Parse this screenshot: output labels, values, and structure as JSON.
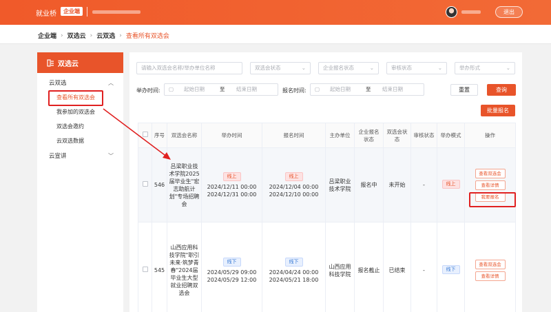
{
  "header": {
    "brand": "就业桥",
    "brand_badge": "企业端",
    "logout": "退出"
  },
  "breadcrumb": [
    "企业端",
    "双选云",
    "云双选",
    "查看所有双选会"
  ],
  "sidebar": {
    "title": "双选云",
    "groups": [
      {
        "label": "云双选",
        "expanded": true,
        "items": [
          "查看所有双选会",
          "我参加的双选会",
          "双选会邀约",
          "云双选数据"
        ]
      },
      {
        "label": "云宣讲",
        "expanded": false,
        "items": []
      }
    ],
    "active_item": "查看所有双选会"
  },
  "filters": {
    "search_placeholder": "请输入双选会名称/举办单位名称",
    "status_placeholder": "双选会状态",
    "enroll_status_placeholder": "企业报名状态",
    "review_status_placeholder": "审核状态",
    "form_placeholder": "举办形式",
    "hold_time_label": "举办时间:",
    "enroll_time_label": "报名时间:",
    "start_date_placeholder": "起始日期",
    "range_to": "至",
    "end_date_placeholder": "结束日期",
    "reset": "重置",
    "query": "查询",
    "batch": "批量报名"
  },
  "table": {
    "columns": [
      "序号",
      "双选会名称",
      "举办时间",
      "报名时间",
      "主办单位",
      "企业报名状态",
      "双选会状态",
      "审核状态",
      "举办模式",
      "操作"
    ],
    "rows": [
      {
        "id": "546",
        "name": "吕梁职业技术学院2025届毕业生\"宏志助航计划\"专场招聘会",
        "hold_tag": "线上",
        "hold_time": "2024/12/11 00:00\n2024/12/31 00:00",
        "enroll_tag": "线上",
        "enroll_time": "2024/12/04 00:00\n2024/12/10 00:00",
        "host": "吕梁职业技术学院",
        "enroll_status": "报名中",
        "fair_status": "未开始",
        "review_status": "-",
        "mode": "线上",
        "actions": [
          "查看双选会",
          "查看详情",
          "我要报名"
        ]
      },
      {
        "id": "545",
        "name": "山西应用科技学院\"职引未来·筑梦青春\"2024届毕业生大型就业招聘双选会",
        "hold_tag": "线下",
        "hold_time": "2024/05/29 09:00\n2024/05/29 12:00",
        "enroll_tag": "线下",
        "enroll_time": "2024/04/24 00:00\n2024/05/21 18:00",
        "host": "山西应用科技学院",
        "enroll_status": "报名截止",
        "fair_status": "已结束",
        "review_status": "-",
        "mode": "线下",
        "actions": [
          "查看双选会",
          "查看详情"
        ]
      }
    ]
  },
  "colors": {
    "brand": "#e8542a",
    "annotation": "#e02020",
    "status_enrolling": "#f0a020",
    "status_not_started": "#1ca36f"
  }
}
